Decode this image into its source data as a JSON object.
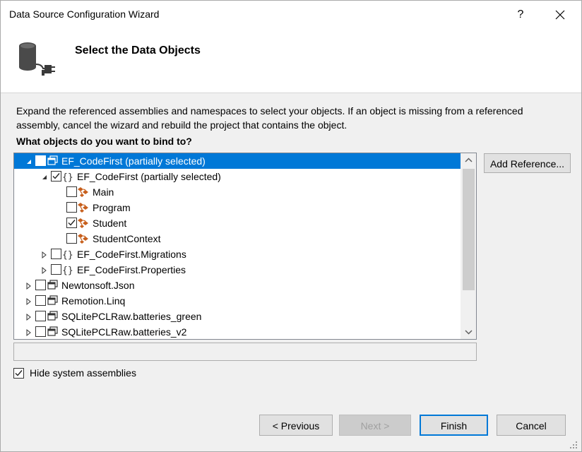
{
  "window": {
    "title": "Data Source Configuration Wizard",
    "help_label": "?"
  },
  "header": {
    "heading": "Select the Data Objects"
  },
  "description": "Expand the referenced assemblies and namespaces to select your objects. If an object is missing from a referenced assembly, cancel the wizard and rebuild the project that contains the object.",
  "question": "What objects do you want to bind to?",
  "tree": [
    {
      "label": "EF_CodeFirst (partially selected)",
      "level": 0,
      "kind": "assembly",
      "expander": "expanded",
      "checked": true,
      "selected": true
    },
    {
      "label": "EF_CodeFirst (partially selected)",
      "level": 1,
      "kind": "namespace",
      "expander": "expanded",
      "checked": true,
      "selected": false
    },
    {
      "label": "Main",
      "level": 2,
      "kind": "class",
      "expander": "none",
      "checked": false,
      "selected": false
    },
    {
      "label": "Program",
      "level": 2,
      "kind": "class",
      "expander": "none",
      "checked": false,
      "selected": false
    },
    {
      "label": "Student",
      "level": 2,
      "kind": "class",
      "expander": "none",
      "checked": true,
      "selected": false
    },
    {
      "label": "StudentContext",
      "level": 2,
      "kind": "class",
      "expander": "none",
      "checked": false,
      "selected": false
    },
    {
      "label": "EF_CodeFirst.Migrations",
      "level": 1,
      "kind": "namespace",
      "expander": "collapsed",
      "checked": false,
      "selected": false
    },
    {
      "label": "EF_CodeFirst.Properties",
      "level": 1,
      "kind": "namespace",
      "expander": "collapsed",
      "checked": false,
      "selected": false
    },
    {
      "label": "Newtonsoft.Json",
      "level": 0,
      "kind": "assembly",
      "expander": "collapsed",
      "checked": false,
      "selected": false
    },
    {
      "label": "Remotion.Linq",
      "level": 0,
      "kind": "assembly",
      "expander": "collapsed",
      "checked": false,
      "selected": false
    },
    {
      "label": "SQLitePCLRaw.batteries_green",
      "level": 0,
      "kind": "assembly",
      "expander": "collapsed",
      "checked": false,
      "selected": false
    },
    {
      "label": "SQLitePCLRaw.batteries_v2",
      "level": 0,
      "kind": "assembly",
      "expander": "collapsed",
      "checked": false,
      "selected": false
    }
  ],
  "add_reference_label": "Add Reference...",
  "hide_system": {
    "label": "Hide system assemblies",
    "checked": true
  },
  "buttons": {
    "previous": "< Previous",
    "next": "Next >",
    "finish": "Finish",
    "cancel": "Cancel"
  },
  "colors": {
    "selection": "#0078d7",
    "class_icon": "#c75f1c",
    "accent": "#0078d7"
  }
}
